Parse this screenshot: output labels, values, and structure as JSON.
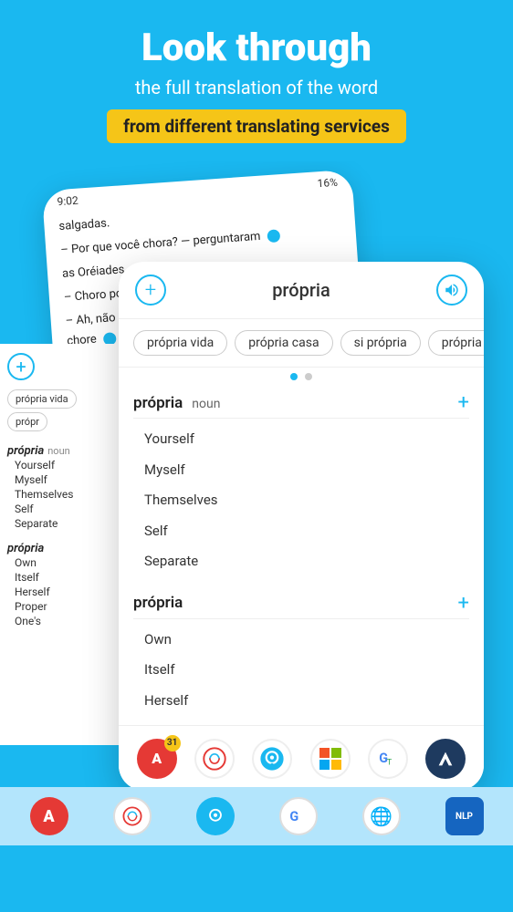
{
  "header": {
    "title": "Look through",
    "subtitle": "the full translation of the word",
    "badge": "from different translating services"
  },
  "colors": {
    "bg": "#1ab8f0",
    "accent": "#1ab8f0",
    "badge": "#f5c518",
    "white": "#ffffff"
  },
  "background_phone": {
    "status_time": "9:02",
    "status_signal": "▲▼",
    "status_battery": "16%",
    "lines": [
      "salgadas.",
      "– Por que você chora? — perguntaram",
      "as Oréiades.",
      "– Choro por Narciso — disse o lago.",
      "– Ah, não nos e  — Ah, não nos espanta que você chore"
    ]
  },
  "foreground_phone": {
    "add_btn_label": "+",
    "word": "própria",
    "sound_btn_label": "🔊",
    "tags": [
      "própria vida",
      "própria casa",
      "si própria",
      "própria c"
    ],
    "dot_active_index": 0,
    "sections": [
      {
        "word": "própria",
        "pos": "noun",
        "translations": [
          "Yourself",
          "Myself",
          "Themselves",
          "Self",
          "Separate"
        ]
      },
      {
        "word": "própria",
        "pos": "",
        "translations": [
          "Own",
          "Itself",
          "Herself"
        ]
      }
    ]
  },
  "bottom_icons": [
    {
      "name": "abbyy",
      "label": "A",
      "badge": "31"
    },
    {
      "name": "reverso",
      "label": "↺"
    },
    {
      "name": "deepl",
      "label": "O"
    },
    {
      "name": "microsoft",
      "label": "⊞"
    },
    {
      "name": "google-translate",
      "label": "G"
    },
    {
      "name": "smartcat",
      "label": "➤"
    }
  ],
  "left_panel": {
    "tags": [
      "própria vida",
      "própr"
    ],
    "sections": [
      {
        "word": "própria",
        "pos": "noun",
        "items": [
          "Yourself",
          "Myself",
          "Themselves",
          "Self",
          "Separate"
        ]
      },
      {
        "word": "própria",
        "pos": "",
        "items": [
          "Own",
          "Itself",
          "Herself",
          "Proper",
          "One's"
        ]
      }
    ]
  },
  "bg_bottom_icons": [
    {
      "name": "abbyy-bg",
      "label": "A"
    },
    {
      "name": "reverso-bg",
      "label": "↺"
    },
    {
      "name": "deepl-bg",
      "label": "O"
    },
    {
      "name": "google-bg",
      "label": "G"
    },
    {
      "name": "language-bg",
      "label": "🌐"
    },
    {
      "name": "nlp-bg",
      "label": "NLP"
    }
  ]
}
